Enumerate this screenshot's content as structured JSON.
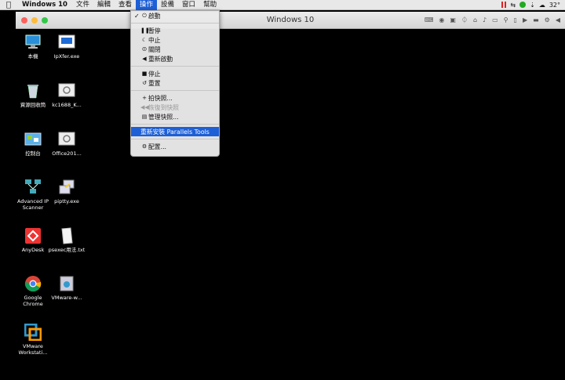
{
  "menubar": {
    "apple_icon": "apple-icon",
    "app_name": "Windows 10",
    "items": [
      "文件",
      "編輯",
      "查看",
      "操作",
      "設備",
      "窗口",
      "幫助"
    ],
    "status_temp": "32°"
  },
  "window": {
    "title": "Windows 10",
    "traffic_lights": {
      "close": "#fc605c",
      "minimize": "#fdbc40",
      "zoom": "#34c84a"
    }
  },
  "desktop_icons": [
    {
      "label": "本機",
      "icon": "computer-icon"
    },
    {
      "label": "IpXfer.exe",
      "icon": "exe-icon"
    },
    {
      "label": "資源回收筒",
      "icon": "recycle-bin-icon"
    },
    {
      "label": "kc1688_K...",
      "icon": "file-icon"
    },
    {
      "label": "控制台",
      "icon": "control-panel-icon"
    },
    {
      "label": "Office201...",
      "icon": "file-icon"
    },
    {
      "label": "Advanced IP Scanner",
      "icon": "network-icon"
    },
    {
      "label": "piptty.exe",
      "icon": "putty-icon"
    },
    {
      "label": "AnyDesk",
      "icon": "anydesk-icon"
    },
    {
      "label": "psexec用法.txt",
      "icon": "text-file-icon"
    },
    {
      "label": "Google Chrome",
      "icon": "chrome-icon"
    },
    {
      "label": "VMware-w...",
      "icon": "vmware-installer-icon"
    },
    {
      "label": "VMware Workstati...",
      "icon": "vmware-icon"
    }
  ],
  "action_menu": {
    "items": [
      {
        "label": "啟動",
        "icon": "power-icon",
        "checked": true
      },
      {
        "label": "暫停",
        "icon": "pause-icon"
      },
      {
        "label": "中止",
        "icon": "moon-icon"
      },
      {
        "label": "關閉",
        "icon": "power-off-icon"
      },
      {
        "label": "重新啟動",
        "icon": "restart-icon"
      },
      {
        "label": "停止",
        "icon": "stop-icon"
      },
      {
        "label": "重置",
        "icon": "reset-icon"
      },
      {
        "label": "拍快照...",
        "icon": "plus-icon"
      },
      {
        "label": "恢復到快照",
        "icon": "rewind-icon",
        "disabled": true
      },
      {
        "label": "管理快照...",
        "icon": "snapshots-icon"
      },
      {
        "label": "重新安裝 Parallels Tools",
        "selected": true
      },
      {
        "label": "配置...",
        "icon": "gear-icon"
      }
    ]
  }
}
